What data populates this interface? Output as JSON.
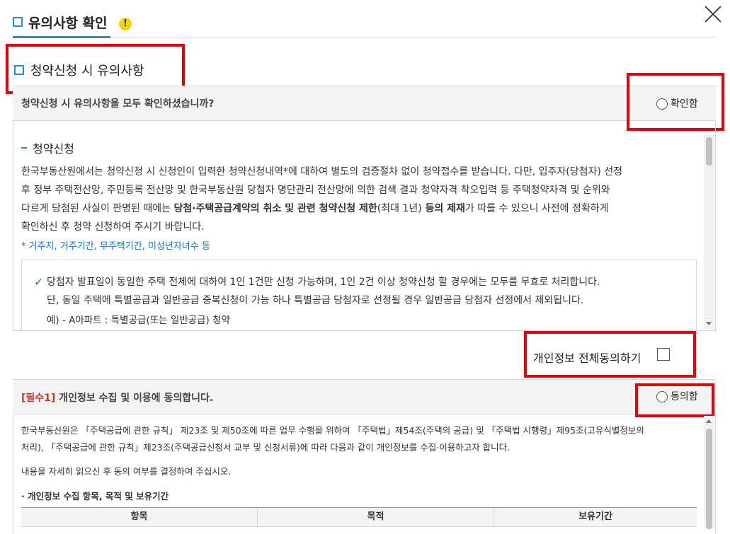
{
  "header": {
    "title": "유의사항 확인",
    "warn": "!"
  },
  "section1": {
    "title": "청약신청 시 유의사항",
    "question": "청약신청 시 유의사항을 모두 확인하셨습니까?",
    "confirm_label": "확인함",
    "sub_title": "청약신청",
    "para1": "한국부동산원에서는 청약신청 시 신청인이 입력한 청약신청내역*에 대하여 별도의 검증절차 없이 청약접수를 받습니다. 다만, 입주자(당첨자) 선정",
    "para2": "후 정부 주택전산망, 주민등록 전산망 및 한국부동산원 당첨자 명단관리 전산망에 의한 검색 결과 청약자격 착오입력 등 주택청약자격 및 순위와",
    "para3a": "다르게 당첨된 사실이 판명된 때에는 ",
    "para3b": "당첨·주택공급계약의 취소 및 관련 청약신청 제한",
    "para3c": "(최대 1년)",
    "para3d": " 등의 제재",
    "para3e": "가 따를 수 있으니 사전에 정확하게",
    "para4": "확인하신 후 청약 신청하여 주시기 바랍니다.",
    "note": "* 거주지, 거주기간, 무주택기간, 미성년자녀수 등",
    "check_mark": "✓",
    "item1": "당첨자 발표일이 동일한 주택 전체에 대하여 1인 1건만 신청 가능하며, 1인 2건 이상 청약신청 할 경우에는 모두를 무효로 처리합니다.",
    "item1b": "단, 동일 주택에 특별공급과 일반공급 중복신청이 가능 하나 특별공급 당첨자로 선정될 경우 일반공급 당첨자 선정에서 제외됩니다.",
    "item1c": "예)  -  A아파트 : 특별공급(또는 일반공급) 청약"
  },
  "agree_all": {
    "label": "개인정보 전체동의하기"
  },
  "section2": {
    "required_tag": "[필수1]",
    "title": " 개인정보 수집 및 이용에 동의합니다.",
    "agree_label": "동의함",
    "para1": "한국부동산원은 「주택공급에 관한 규칙」 제23조 및 제50조에 따른 업무 수행을 위하여 「주택법」제54조(주택의 공급) 및 「주택법 시행령」제95조(고유식별정보의",
    "para2": "처리), 「주택공급에 관한 규칙」제23조(주택공급신청서 교부 및 신청서류)에 따라 다음과 같이 개인정보를 수집·이용하고자 합니다.",
    "para3": "내용을 자세히 읽으신 후 동의 여부를 결정하여 주십시오.",
    "sub_title": "· 개인정보 수집 항목, 목적 및 보유기간",
    "table_headers": [
      "항목",
      "목적",
      "보유기간"
    ]
  },
  "colors": {
    "accent": "#1e8fe0",
    "highlight": "#e8000b",
    "link": "#1673c7"
  }
}
